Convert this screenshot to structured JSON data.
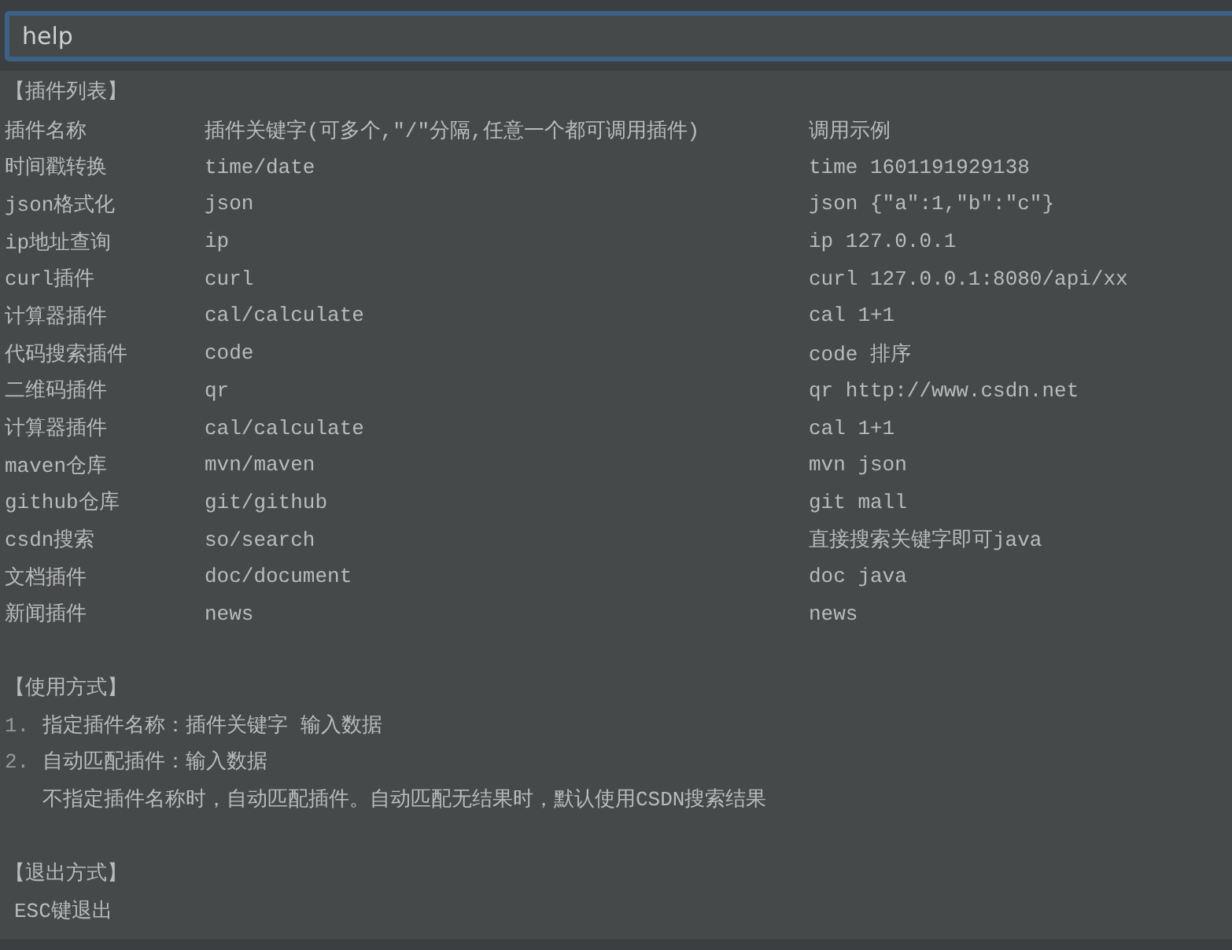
{
  "search": {
    "value": "help"
  },
  "plugin_list": {
    "heading": "【插件列表】",
    "columns": [
      "插件名称",
      "插件关键字(可多个,\"/\"分隔,任意一个都可调用插件)",
      "调用示例"
    ],
    "rows": [
      [
        "时间戳转换",
        "time/date",
        "time 1601191929138"
      ],
      [
        "json格式化",
        "json",
        "json {\"a\":1,\"b\":\"c\"}"
      ],
      [
        "ip地址查询",
        "ip",
        "ip 127.0.0.1"
      ],
      [
        "curl插件",
        "curl",
        "curl 127.0.0.1:8080/api/xx"
      ],
      [
        "计算器插件",
        "cal/calculate",
        "cal 1+1"
      ],
      [
        "代码搜索插件",
        "code",
        "code 排序"
      ],
      [
        "二维码插件",
        "qr",
        "qr http://www.csdn.net"
      ],
      [
        "计算器插件",
        "cal/calculate",
        "cal 1+1"
      ],
      [
        "maven仓库",
        "mvn/maven",
        "mvn json"
      ],
      [
        "github仓库",
        "git/github",
        "git mall"
      ],
      [
        "csdn搜索",
        "so/search",
        "直接搜索关键字即可java"
      ],
      [
        "文档插件",
        "doc/document",
        "doc java"
      ],
      [
        "新闻插件",
        "news",
        "news"
      ]
    ]
  },
  "usage": {
    "heading": "【使用方式】",
    "steps": [
      {
        "number": "1.",
        "text": "指定插件名称：插件关键字 输入数据"
      },
      {
        "number": "2.",
        "text": "自动匹配插件：输入数据"
      }
    ],
    "note": "不指定插件名称时，自动匹配插件。自动匹配无结果时，默认使用CSDN搜索结果"
  },
  "exit": {
    "heading": "【退出方式】",
    "text": "ESC键退出"
  }
}
